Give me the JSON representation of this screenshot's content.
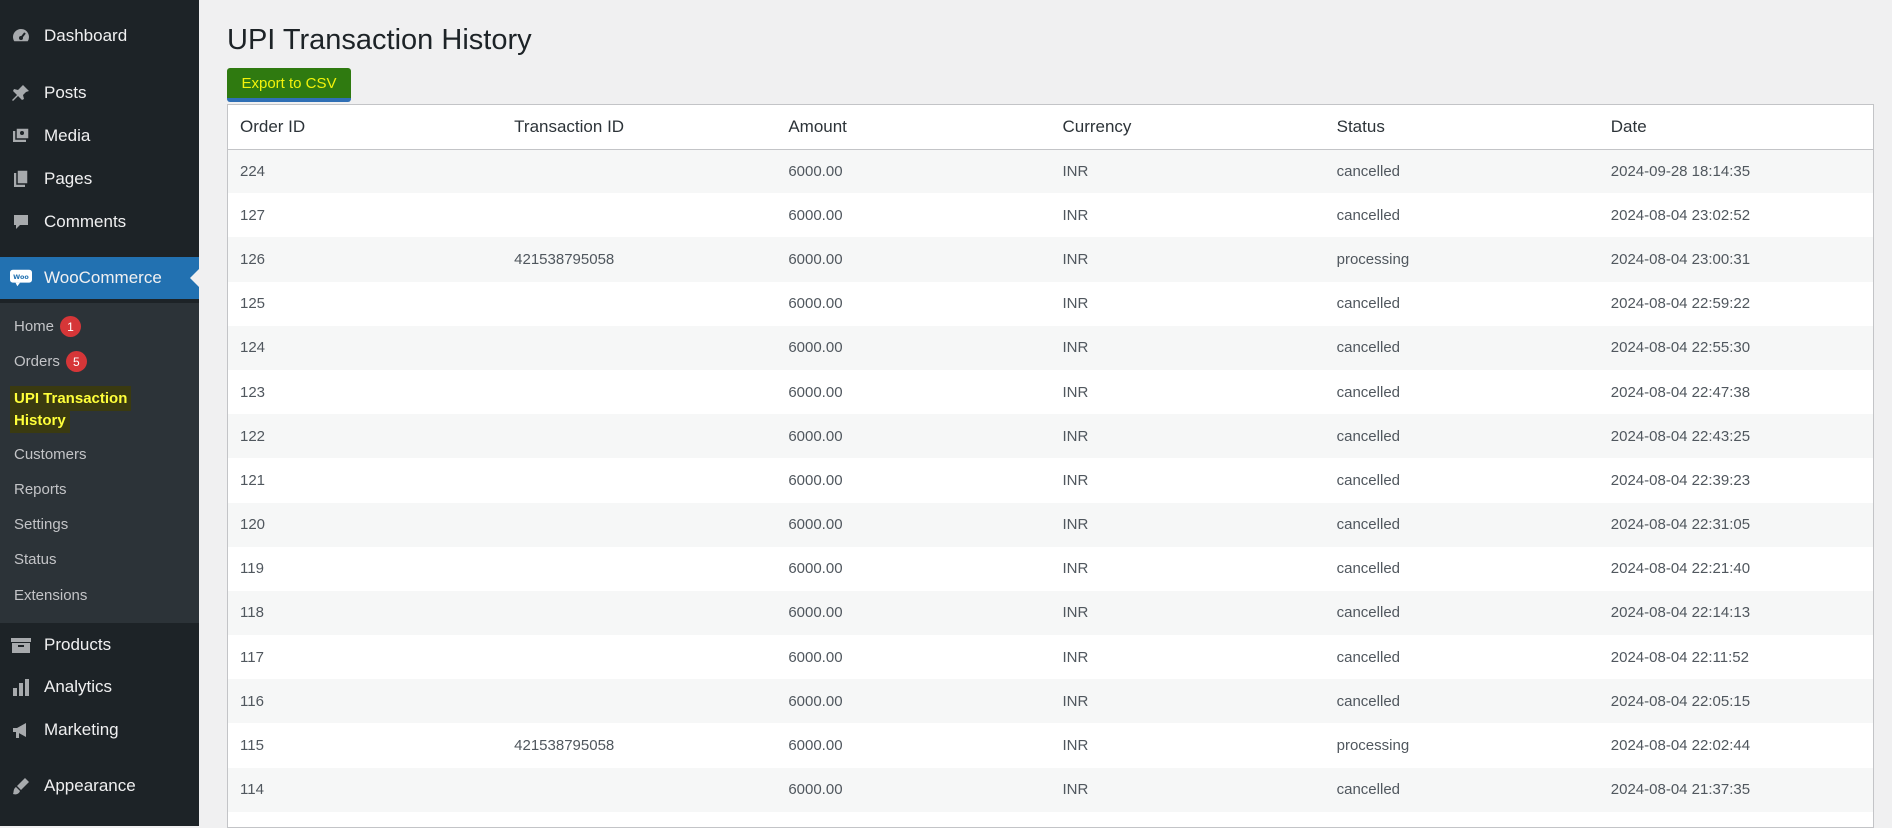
{
  "sidebar": {
    "items_top": [
      {
        "label": "Dashboard",
        "icon": "dashboard-icon"
      },
      {
        "label": "Posts",
        "icon": "pin-icon"
      },
      {
        "label": "Media",
        "icon": "media-icon"
      },
      {
        "label": "Pages",
        "icon": "pages-icon"
      },
      {
        "label": "Comments",
        "icon": "comment-icon"
      },
      {
        "label": "WooCommerce",
        "icon": "woo-icon"
      }
    ],
    "submenu": {
      "home_label": "Home",
      "home_badge": "1",
      "orders_label": "Orders",
      "orders_badge": "5",
      "current_line1": "UPI Transaction",
      "current_line2": "History",
      "customers_label": "Customers",
      "reports_label": "Reports",
      "settings_label": "Settings",
      "status_label": "Status",
      "extensions_label": "Extensions"
    },
    "items_bottom": [
      {
        "label": "Products",
        "icon": "products-icon"
      },
      {
        "label": "Analytics",
        "icon": "analytics-icon"
      },
      {
        "label": "Marketing",
        "icon": "megaphone-icon"
      },
      {
        "label": "Appearance",
        "icon": "brush-icon"
      }
    ]
  },
  "main": {
    "title": "UPI Transaction History",
    "export_label": "Export to CSV",
    "columns": [
      "Order ID",
      "Transaction ID",
      "Amount",
      "Currency",
      "Status",
      "Date"
    ],
    "rows": [
      [
        "224",
        "",
        "6000.00",
        "INR",
        "cancelled",
        "2024-09-28 18:14:35"
      ],
      [
        "127",
        "",
        "6000.00",
        "INR",
        "cancelled",
        "2024-08-04 23:02:52"
      ],
      [
        "126",
        "421538795058",
        "6000.00",
        "INR",
        "processing",
        "2024-08-04 23:00:31"
      ],
      [
        "125",
        "",
        "6000.00",
        "INR",
        "cancelled",
        "2024-08-04 22:59:22"
      ],
      [
        "124",
        "",
        "6000.00",
        "INR",
        "cancelled",
        "2024-08-04 22:55:30"
      ],
      [
        "123",
        "",
        "6000.00",
        "INR",
        "cancelled",
        "2024-08-04 22:47:38"
      ],
      [
        "122",
        "",
        "6000.00",
        "INR",
        "cancelled",
        "2024-08-04 22:43:25"
      ],
      [
        "121",
        "",
        "6000.00",
        "INR",
        "cancelled",
        "2024-08-04 22:39:23"
      ],
      [
        "120",
        "",
        "6000.00",
        "INR",
        "cancelled",
        "2024-08-04 22:31:05"
      ],
      [
        "119",
        "",
        "6000.00",
        "INR",
        "cancelled",
        "2024-08-04 22:21:40"
      ],
      [
        "118",
        "",
        "6000.00",
        "INR",
        "cancelled",
        "2024-08-04 22:14:13"
      ],
      [
        "117",
        "",
        "6000.00",
        "INR",
        "cancelled",
        "2024-08-04 22:11:52"
      ],
      [
        "116",
        "",
        "6000.00",
        "INR",
        "cancelled",
        "2024-08-04 22:05:15"
      ],
      [
        "115",
        "421538795058",
        "6000.00",
        "INR",
        "processing",
        "2024-08-04 22:02:44"
      ],
      [
        "114",
        "",
        "6000.00",
        "INR",
        "cancelled",
        "2024-08-04 21:37:35"
      ]
    ]
  }
}
